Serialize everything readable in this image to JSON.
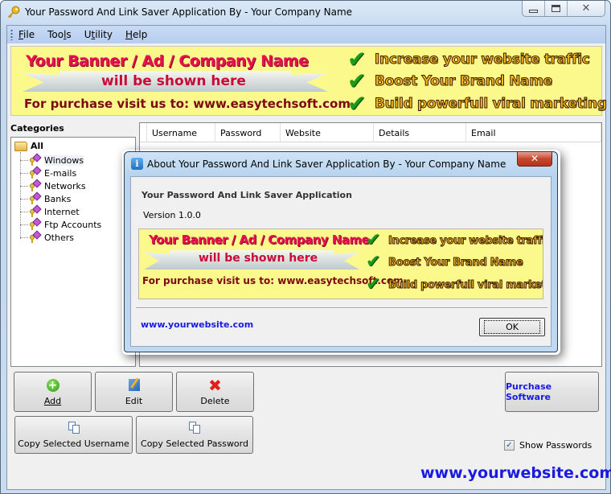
{
  "window": {
    "title": "Your Password And Link Saver Application By - Your Company Name",
    "icon": "key-icon",
    "controls": {
      "minimize": "minimize-icon",
      "maximize": "maximize-icon",
      "close": "close-icon"
    }
  },
  "menu": {
    "items": [
      {
        "label": "File",
        "mnemonic": "F"
      },
      {
        "label": "Tools",
        "mnemonic": "l"
      },
      {
        "label": "Utility",
        "mnemonic": "t"
      },
      {
        "label": "Help",
        "mnemonic": "H"
      }
    ]
  },
  "banner": {
    "line1": "Your Banner / Ad / Company Name",
    "line2": "will be shown here",
    "line3": "For purchase visit us to: www.easytechsoft.com",
    "features": [
      "Increase your website traffic",
      "Boost Your Brand Name",
      "Build powerfull viral marketing"
    ],
    "check_glyph": "✔"
  },
  "categories": {
    "label": "Categories",
    "root": "All",
    "items": [
      "Windows",
      "E-mails",
      "Networks",
      "Banks",
      "Internet",
      "Ftp Accounts",
      "Others"
    ],
    "selected": "Windows"
  },
  "table": {
    "columns": [
      "Username",
      "Password",
      "Website",
      "Details",
      "Email"
    ],
    "rows": []
  },
  "buttons": {
    "add": "Add",
    "edit": "Edit",
    "delete": "Delete",
    "copy_username": "Copy Selected Username",
    "copy_password": "Copy Selected Password",
    "purchase": "Purchase Software"
  },
  "show_passwords": {
    "label": "Show Passwords",
    "checked": true
  },
  "website": "www.yourwebsite.com",
  "about_dialog": {
    "title": "About Your Password And Link Saver Application By - Your Company Name",
    "app_name": "Your Password And Link Saver Application",
    "version": "Version 1.0.0",
    "website": "www.yourwebsite.com",
    "ok_label": "OK",
    "close_glyph": "✕"
  },
  "colors": {
    "banner_bg": "#fcf98c",
    "link_blue": "#1a1ae0",
    "banner_red": "#e5124e",
    "check_green": "#1d9a18"
  }
}
